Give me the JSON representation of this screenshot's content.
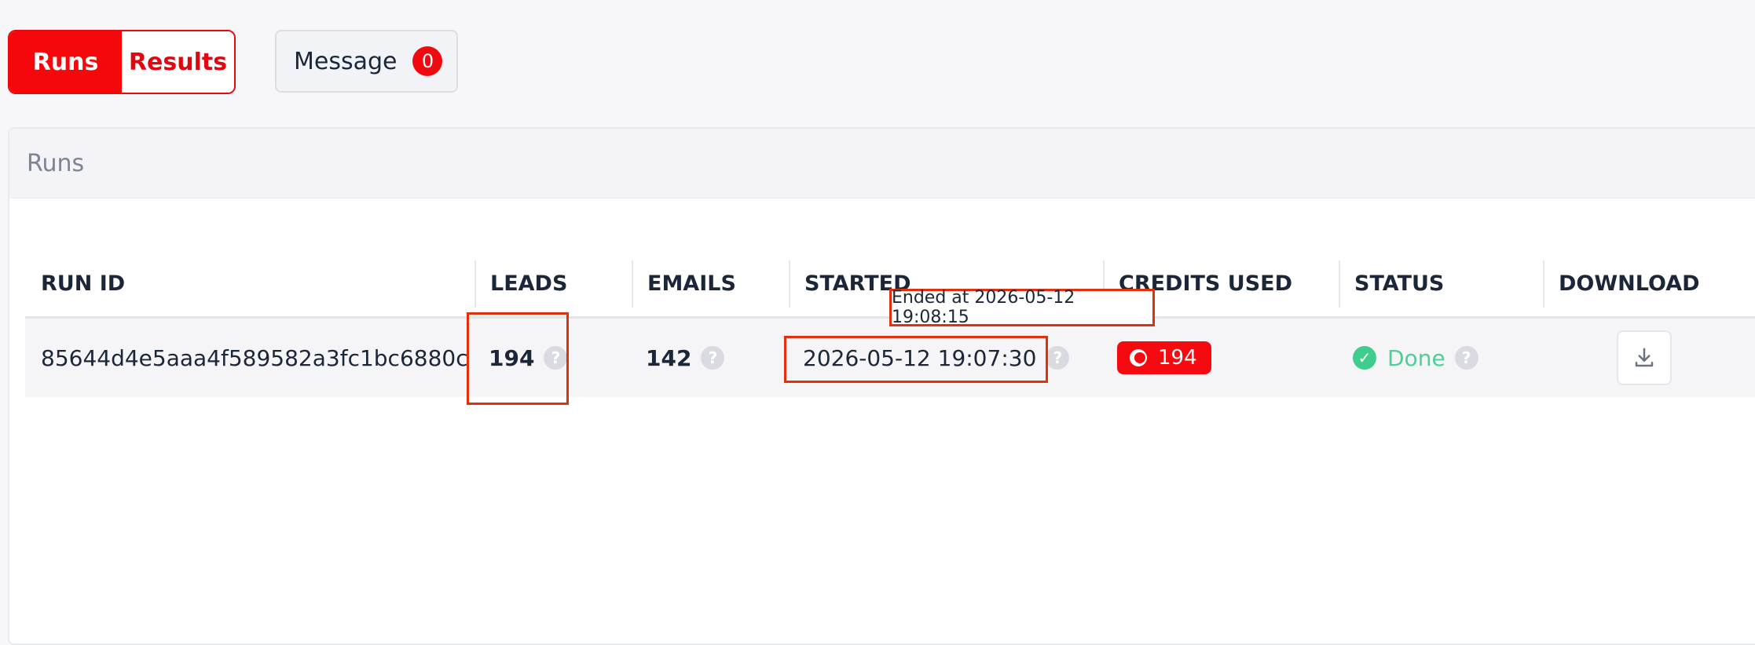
{
  "tabs": {
    "runs": "Runs",
    "results": "Results"
  },
  "message": {
    "label": "Message",
    "count": "0"
  },
  "panel": {
    "title": "Runs"
  },
  "table": {
    "headers": [
      "RUN ID",
      "LEADS",
      "EMAILS",
      "STARTED",
      "CREDITS USED",
      "STATUS",
      "DOWNLOAD"
    ],
    "rows": [
      {
        "run_id": "85644d4e5aaa4f589582a3fc1bc6880c",
        "leads": "194",
        "emails": "142",
        "started": "2026-05-12 19:07:30",
        "credits": "194",
        "status": "Done",
        "help": "?"
      }
    ]
  },
  "tooltip": {
    "text": "Ended at 2026-05-12 19:08:15"
  },
  "icons": [
    "help-icon",
    "coin-icon",
    "check-circle-icon",
    "download-icon"
  ],
  "colors": {
    "accent": "#f5070c",
    "success": "#3fcd8d",
    "highlight": "#e1300e"
  }
}
